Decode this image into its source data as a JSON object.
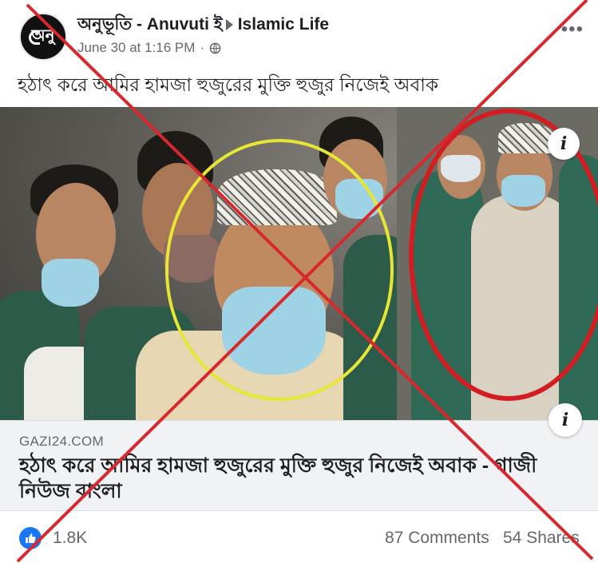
{
  "header": {
    "page_name": "অনুভূতি - Anuvuti ই",
    "group_name": "Islamic Life",
    "timestamp": "June 30 at 1:16 PM",
    "separator": "·",
    "more_icon": "more-horizontal-icon",
    "privacy_icon": "globe-icon"
  },
  "post": {
    "text": "হঠাৎ করে আমির হামজা হুজুরের মুক্তি হুজুর নিজেই অবাক"
  },
  "link_preview": {
    "domain": "GAZI24.COM",
    "title": "হঠাৎ করে আমির হামজা হুজুরের মুক্তি হুজুর নিজেই অবাক - গাজী নিউজ বাংলা",
    "info_badge": "i"
  },
  "footer": {
    "reactions_count": "1.8K",
    "comments": "87 Comments",
    "shares": "54 Shares"
  },
  "colors": {
    "cross_red": "#d7282e",
    "yellow_ring": "#e7e635",
    "red_ring": "#d21e23",
    "like_blue": "#1877f2"
  }
}
